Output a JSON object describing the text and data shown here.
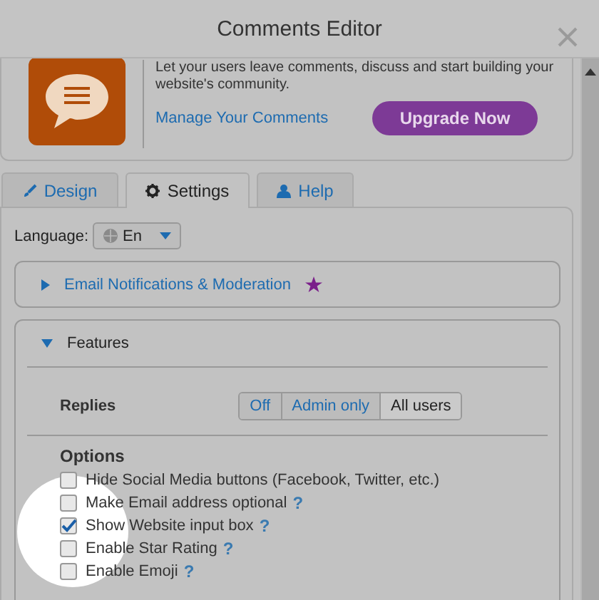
{
  "window": {
    "title": "Comments Editor"
  },
  "app": {
    "description": "Let your users leave comments, discuss and start building your website's community.",
    "link": "Manage Your Comments",
    "upgrade_button": "Upgrade Now"
  },
  "tabs": [
    {
      "label": "Design",
      "selected": false
    },
    {
      "label": "Settings",
      "selected": true
    },
    {
      "label": "Help",
      "selected": false
    }
  ],
  "language": {
    "label": "Language:",
    "value": "En"
  },
  "sections": [
    {
      "title": "Email Notifications & Moderation",
      "expanded": false,
      "premium": true
    },
    {
      "title": "Features",
      "expanded": true,
      "premium": false
    }
  ],
  "replies": {
    "label": "Replies",
    "options": [
      {
        "label": "Off",
        "selected": false
      },
      {
        "label": "Admin only",
        "selected": false
      },
      {
        "label": "All users",
        "selected": true
      }
    ]
  },
  "options": {
    "title": "Options",
    "items": [
      {
        "label": "Hide Social Media buttons (Facebook, Twitter, etc.)",
        "checked": false
      },
      {
        "label": "Make Email address optional",
        "checked": false,
        "help": "?"
      },
      {
        "label": "Show Website input box",
        "checked": true,
        "help": "?"
      },
      {
        "label": "Enable Star Rating",
        "checked": false,
        "help": "?"
      },
      {
        "label": "Enable Emoji",
        "checked": false,
        "help": "?"
      }
    ]
  }
}
